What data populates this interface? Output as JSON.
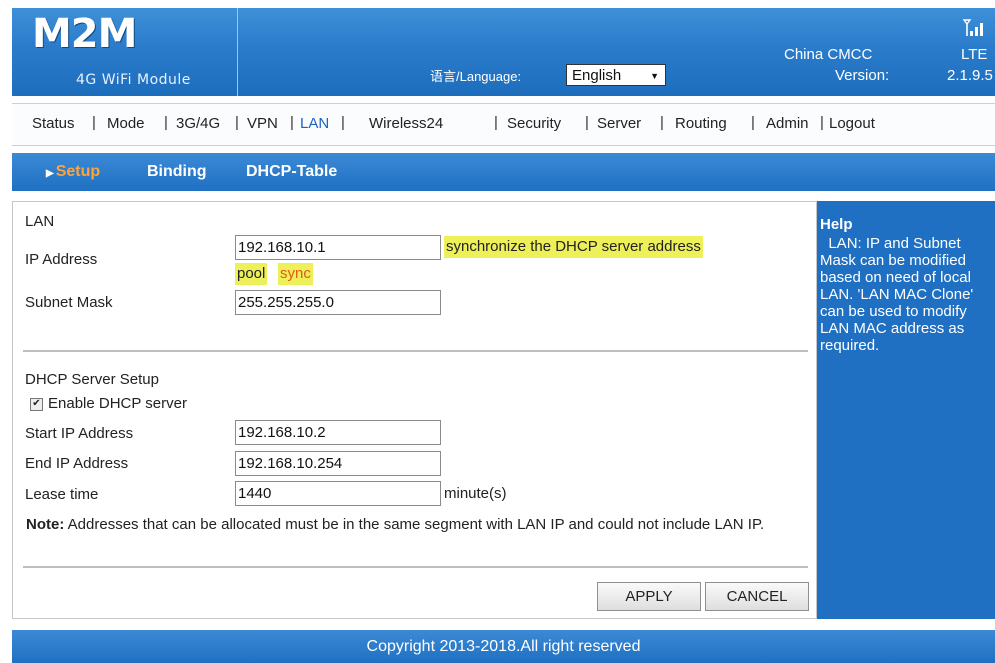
{
  "header": {
    "logo": "M2M",
    "subtitle": "4G WiFi Module",
    "language_label": "语言/Language:",
    "language_value": "English",
    "carrier": "China CMCC",
    "network": "LTE",
    "version_label": "Version:",
    "version_value": "2.1.9.5"
  },
  "nav": {
    "items": [
      "Status",
      "Mode",
      "3G/4G",
      "VPN",
      "LAN",
      "Wireless24",
      "Security",
      "Server",
      "Routing",
      "Admin",
      "Logout"
    ],
    "active": "LAN"
  },
  "subtabs": {
    "items": [
      "Setup",
      "Binding",
      "DHCP-Table"
    ],
    "active": "Setup"
  },
  "lan": {
    "section_title": "LAN",
    "ip_label": "IP Address",
    "ip_value": "192.168.10.1",
    "sync_hint_1": "synchronize the DHCP server address",
    "sync_hint_2": "pool",
    "sync_link": "sync",
    "mask_label": "Subnet Mask",
    "mask_value": "255.255.255.0"
  },
  "dhcp": {
    "section_title": "DHCP Server Setup",
    "enable_label": "Enable DHCP server",
    "enabled": true,
    "start_label": "Start IP Address",
    "start_value": "192.168.10.2",
    "end_label": "End IP Address",
    "end_value": "192.168.10.254",
    "lease_label": "Lease time",
    "lease_value": "1440",
    "lease_unit": "minute(s)",
    "note_label": "Note:",
    "note_text": " Addresses that can be allocated must be in the same segment with LAN IP and could not include LAN IP."
  },
  "buttons": {
    "apply": "APPLY",
    "cancel": "CANCEL"
  },
  "help": {
    "title": "Help",
    "text": "  LAN: IP and Subnet Mask can be modified based on need of local LAN. 'LAN MAC Clone' can be used to modify LAN MAC address as required."
  },
  "footer": {
    "copyright": "Copyright 2013-2018.All right reserved"
  }
}
